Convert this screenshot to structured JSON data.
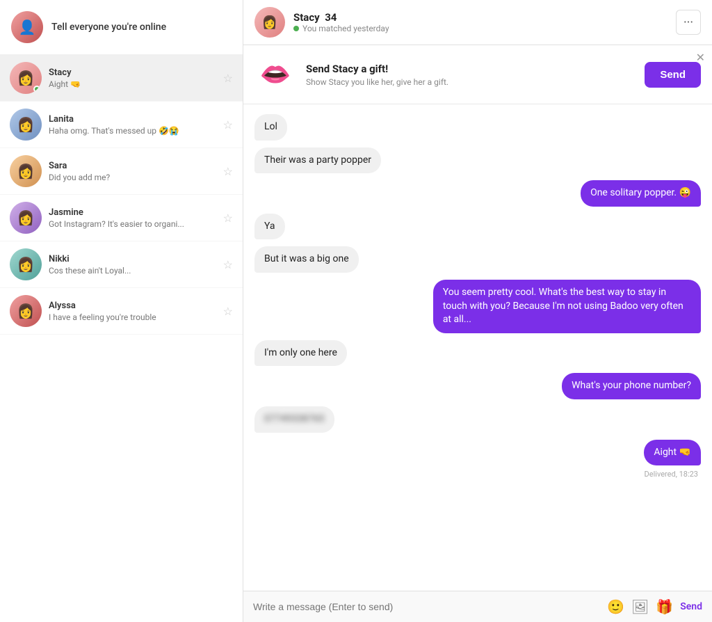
{
  "sidebar": {
    "banner_text": "Tell everyone you're online",
    "conversations": [
      {
        "id": "stacy",
        "name": "Stacy",
        "preview": "Aight 🤜",
        "online": true,
        "avatar_class": "av-pink",
        "avatar_emoji": "👩"
      },
      {
        "id": "user2",
        "name": "Lanita",
        "preview": "Haha omg. That's messed up 🤣😭",
        "online": false,
        "avatar_class": "av-blue",
        "avatar_emoji": "👩"
      },
      {
        "id": "user3",
        "name": "Sara",
        "preview": "Did you add me?",
        "online": false,
        "avatar_class": "av-orange",
        "avatar_emoji": "👩"
      },
      {
        "id": "user4",
        "name": "Jasmine",
        "preview": "Got Instagram? It's easier to organi...",
        "online": false,
        "avatar_class": "av-purple",
        "avatar_emoji": "👩"
      },
      {
        "id": "user5",
        "name": "Nikki",
        "preview": "Cos these ain't Loyal...",
        "online": false,
        "avatar_class": "av-teal",
        "avatar_emoji": "👩"
      },
      {
        "id": "user6",
        "name": "Alyssa",
        "preview": "I have a feeling you're trouble",
        "online": false,
        "avatar_class": "av-red",
        "avatar_emoji": "👩"
      }
    ]
  },
  "chat": {
    "header": {
      "name": "Stacy",
      "age": "34",
      "status": "You matched yesterday",
      "more_label": "···"
    },
    "gift_banner": {
      "title": "Send Stacy a gift!",
      "subtitle": "Show Stacy you like her, give her a gift.",
      "send_label": "Send"
    },
    "messages": [
      {
        "id": 1,
        "type": "received",
        "text": "Lol"
      },
      {
        "id": 2,
        "type": "received",
        "text": "Their was a party popper"
      },
      {
        "id": 3,
        "type": "sent",
        "text": "One solitary popper. 😜"
      },
      {
        "id": 4,
        "type": "received",
        "text": "Ya"
      },
      {
        "id": 5,
        "type": "received",
        "text": "But it was a big one"
      },
      {
        "id": 6,
        "type": "sent",
        "text": "You seem pretty cool. What's the best way to stay in touch with you? Because I'm not using Badoo very often at all..."
      },
      {
        "id": 7,
        "type": "received",
        "text": "I'm only one here"
      },
      {
        "id": 8,
        "type": "sent",
        "text": "What's your phone number?"
      },
      {
        "id": 9,
        "type": "received",
        "text": "BLURRED_NUMBER",
        "blurred": true
      },
      {
        "id": 10,
        "type": "sent",
        "text": "Aight 🤜",
        "meta": "Delivered, 18:23"
      }
    ],
    "input": {
      "placeholder": "Write a message (Enter to send)",
      "send_label": "Send"
    }
  }
}
